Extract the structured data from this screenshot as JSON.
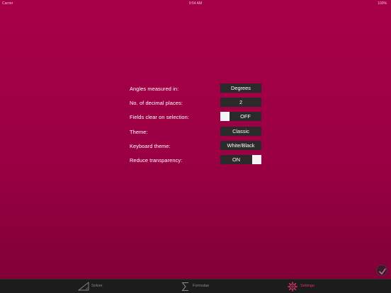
{
  "status_bar": {
    "carrier": "Carrier",
    "time": "9:54 AM",
    "battery": "100%"
  },
  "settings": [
    {
      "label": "Angles measured in:",
      "type": "value",
      "value": "Degrees"
    },
    {
      "label": "No. of decimal places:",
      "type": "value",
      "value": "2"
    },
    {
      "label": "Fields clear on selection:",
      "type": "toggle",
      "value": "OFF"
    },
    {
      "label": "Theme:",
      "type": "value",
      "value": "Classic"
    },
    {
      "label": "Keyboard theme:",
      "type": "value",
      "value": "White/Black"
    },
    {
      "label": "Reduce transparency:",
      "type": "toggle",
      "value": "ON"
    }
  ],
  "tabs": [
    {
      "label": "Solver",
      "icon": "triangle-icon",
      "active": false
    },
    {
      "label": "Formulae",
      "icon": "sigma-icon",
      "active": false
    },
    {
      "label": "Settings",
      "icon": "gear-icon",
      "active": true
    }
  ],
  "colors": {
    "background": "#a80048",
    "control": "#2a2a2a",
    "tab_bar": "#1c1c1c",
    "active_tab": "#e0306e",
    "inactive_tab": "#8a8a8a"
  }
}
